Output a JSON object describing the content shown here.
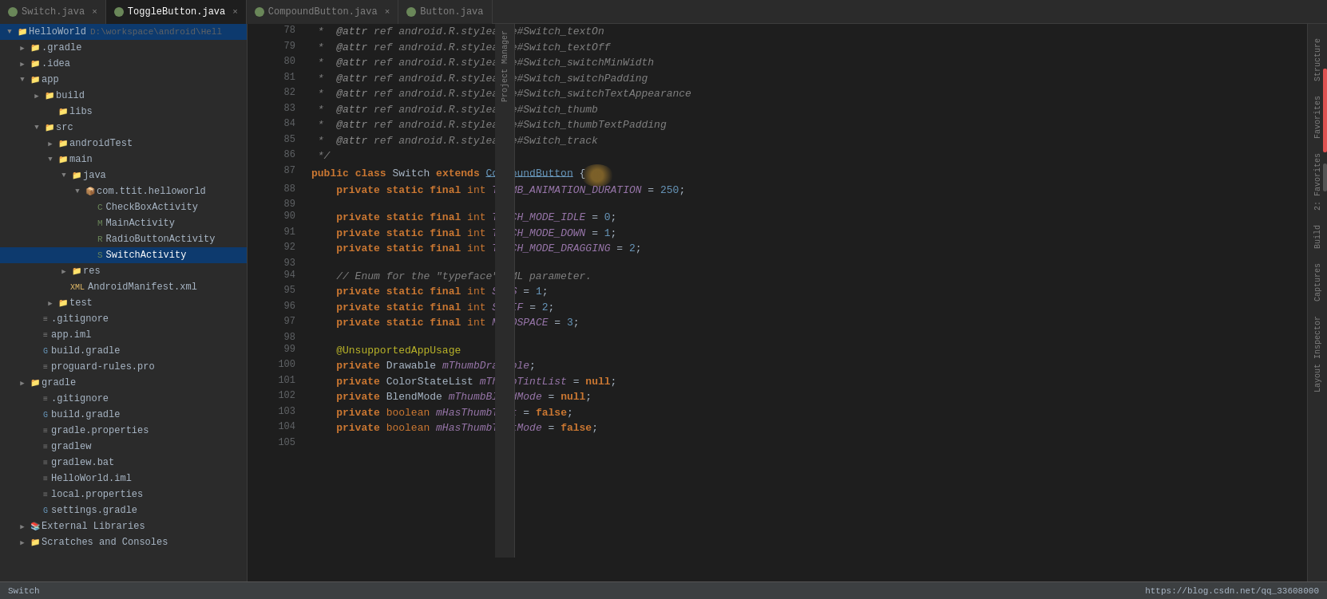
{
  "tabs": [
    {
      "id": "switch",
      "label": "Switch.java",
      "active": false,
      "color": "#6a8759"
    },
    {
      "id": "togglebutton",
      "label": "ToggleButton.java",
      "active": true,
      "color": "#6a8759"
    },
    {
      "id": "compoundbutton",
      "label": "CompoundButton.java",
      "active": false,
      "color": "#6a8759"
    },
    {
      "id": "button",
      "label": "Button.java",
      "active": false,
      "color": "#6a8759"
    }
  ],
  "project_title": "HelloWorld",
  "project_path": "D:\\workspace\\android\\Hell",
  "sidebar": {
    "items": [
      {
        "label": "HelloWorld",
        "indent": 0,
        "type": "project",
        "expanded": true
      },
      {
        "label": ".gradle",
        "indent": 1,
        "type": "folder",
        "expanded": false
      },
      {
        "label": ".idea",
        "indent": 1,
        "type": "folder",
        "expanded": false
      },
      {
        "label": "app",
        "indent": 1,
        "type": "folder",
        "expanded": true
      },
      {
        "label": "build",
        "indent": 2,
        "type": "folder",
        "expanded": false
      },
      {
        "label": "libs",
        "indent": 3,
        "type": "folder",
        "expanded": false
      },
      {
        "label": "src",
        "indent": 2,
        "type": "folder",
        "expanded": true
      },
      {
        "label": "androidTest",
        "indent": 3,
        "type": "folder",
        "expanded": false
      },
      {
        "label": "main",
        "indent": 3,
        "type": "folder",
        "expanded": true
      },
      {
        "label": "java",
        "indent": 4,
        "type": "folder",
        "expanded": true
      },
      {
        "label": "com.ttit.helloworld",
        "indent": 5,
        "type": "folder",
        "expanded": true
      },
      {
        "label": "CheckBoxActivity",
        "indent": 6,
        "type": "java",
        "expanded": false
      },
      {
        "label": "MainActivity",
        "indent": 6,
        "type": "java",
        "expanded": false
      },
      {
        "label": "RadioButtonActivity",
        "indent": 6,
        "type": "java",
        "expanded": false
      },
      {
        "label": "SwitchActivity",
        "indent": 6,
        "type": "java",
        "expanded": false,
        "selected": true
      },
      {
        "label": "res",
        "indent": 4,
        "type": "folder",
        "expanded": false
      },
      {
        "label": "AndroidManifest.xml",
        "indent": 4,
        "type": "xml",
        "expanded": false
      },
      {
        "label": "test",
        "indent": 3,
        "type": "folder",
        "expanded": false
      },
      {
        "label": ".gitignore",
        "indent": 2,
        "type": "file",
        "expanded": false
      },
      {
        "label": "app.iml",
        "indent": 2,
        "type": "file",
        "expanded": false
      },
      {
        "label": "build.gradle",
        "indent": 2,
        "type": "gradle",
        "expanded": false
      },
      {
        "label": "proguard-rules.pro",
        "indent": 2,
        "type": "file",
        "expanded": false
      },
      {
        "label": "gradle",
        "indent": 1,
        "type": "folder",
        "expanded": false
      },
      {
        "label": ".gitignore",
        "indent": 2,
        "type": "file",
        "expanded": false
      },
      {
        "label": "build.gradle",
        "indent": 2,
        "type": "gradle",
        "expanded": false
      },
      {
        "label": "gradle.properties",
        "indent": 2,
        "type": "file",
        "expanded": false
      },
      {
        "label": "gradlew",
        "indent": 2,
        "type": "file",
        "expanded": false
      },
      {
        "label": "gradlew.bat",
        "indent": 2,
        "type": "file",
        "expanded": false
      },
      {
        "label": "HelloWorld.iml",
        "indent": 2,
        "type": "file",
        "expanded": false
      },
      {
        "label": "local.properties",
        "indent": 2,
        "type": "file",
        "expanded": false
      },
      {
        "label": "settings.gradle",
        "indent": 2,
        "type": "gradle",
        "expanded": false
      },
      {
        "label": "External Libraries",
        "indent": 1,
        "type": "folder",
        "expanded": false
      },
      {
        "label": "Scratches and Consoles",
        "indent": 1,
        "type": "folder",
        "expanded": false
      }
    ]
  },
  "code_lines": [
    {
      "num": 78,
      "content": " *  @attr ref android.R.styleable#Switch_textOn"
    },
    {
      "num": 79,
      "content": " *  @attr ref android.R.styleable#Switch_textOff"
    },
    {
      "num": 80,
      "content": " *  @attr ref android.R.styleable#Switch_switchMinWidth"
    },
    {
      "num": 81,
      "content": " *  @attr ref android.R.styleable#Switch_switchPadding"
    },
    {
      "num": 82,
      "content": " *  @attr ref android.R.styleable#Switch_switchTextAppearance"
    },
    {
      "num": 83,
      "content": " *  @attr ref android.R.styleable#Switch_thumb"
    },
    {
      "num": 84,
      "content": " *  @attr ref android.R.styleable#Switch_thumbTextPadding"
    },
    {
      "num": 85,
      "content": " *  @attr ref android.R.styleable#Switch_track"
    },
    {
      "num": 86,
      "content": " */"
    },
    {
      "num": 87,
      "content": "public class Switch extends CompoundButton {"
    },
    {
      "num": 88,
      "content": "    private static final int THUMB_ANIMATION_DURATION = 250;"
    },
    {
      "num": 89,
      "content": ""
    },
    {
      "num": 90,
      "content": "    private static final int TOUCH_MODE_IDLE = 0;"
    },
    {
      "num": 91,
      "content": "    private static final int TOUCH_MODE_DOWN = 1;"
    },
    {
      "num": 92,
      "content": "    private static final int TOUCH_MODE_DRAGGING = 2;"
    },
    {
      "num": 93,
      "content": ""
    },
    {
      "num": 94,
      "content": "    // Enum for the \"typeface\" XML parameter."
    },
    {
      "num": 95,
      "content": "    private static final int SANS = 1;"
    },
    {
      "num": 96,
      "content": "    private static final int SERIF = 2;"
    },
    {
      "num": 97,
      "content": "    private static final int MONOSPACE = 3;"
    },
    {
      "num": 98,
      "content": ""
    },
    {
      "num": 99,
      "content": "    @UnsupportedAppUsage"
    },
    {
      "num": 100,
      "content": "    private Drawable mThumbDrawable;"
    },
    {
      "num": 101,
      "content": "    private ColorStateList mThumbTintList = null;"
    },
    {
      "num": 102,
      "content": "    private BlendMode mThumbBlendMode = null;"
    },
    {
      "num": 103,
      "content": "    private boolean mHasThumbTint = false;"
    },
    {
      "num": 104,
      "content": "    private boolean mHasThumbTintMode = false;"
    },
    {
      "num": 105,
      "content": ""
    }
  ],
  "status_bar": {
    "left": "Switch",
    "right": "https://blog.csdn.net/qq_33608000"
  },
  "side_tools_right": [
    "Structure",
    "Favorites",
    "2: Favorites",
    "Build",
    "Captures",
    "Layout Inspector"
  ],
  "side_tools_left": [
    "Project Manager"
  ]
}
